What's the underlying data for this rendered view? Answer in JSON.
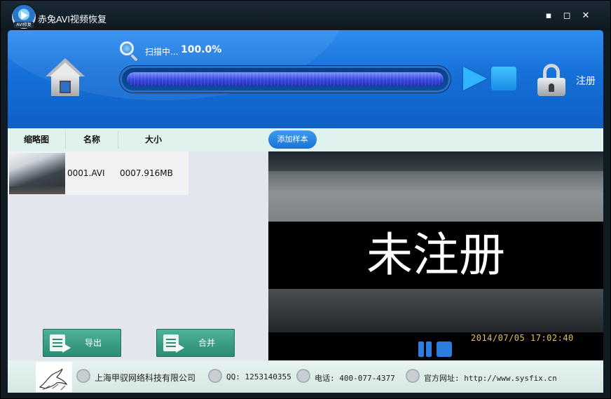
{
  "window": {
    "title": "赤兔AVI视频恢复",
    "logo_tag": "AVI修复",
    "minimize": "▪",
    "maximize": "◻",
    "close": "✕"
  },
  "header": {
    "scan_label": "扫描中...",
    "scan_percent": "100.0%",
    "progress_fraction": 1.0,
    "register_label": "注册"
  },
  "list": {
    "columns": [
      "缩略图",
      "名称",
      "大小"
    ],
    "add_sample_label": "添加样本",
    "rows": [
      {
        "name": "0001.AVI",
        "size": "0007.916MB"
      }
    ],
    "export_label": "导出",
    "merge_label": "合并"
  },
  "preview": {
    "watermark": "未注册",
    "timestamp": "2014/07/05  17:02:40"
  },
  "footer": {
    "company": "上海甲驭网络科技有限公司",
    "qq": "QQ: 1253140355",
    "phone": "电话: 400-077-4377",
    "website": "官方网址: http://www.sysfix.cn"
  },
  "colors": {
    "accent": "#1570d8",
    "progress": "#3344d8",
    "button_green": "#2b8b73",
    "timestamp": "#e8c24a"
  }
}
